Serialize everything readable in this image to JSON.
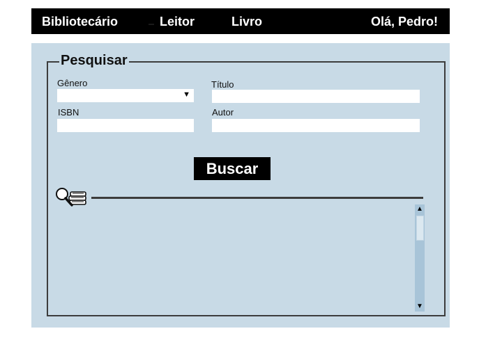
{
  "nav": {
    "items": [
      {
        "label": "Bibliotecário"
      },
      {
        "label": "Leitor"
      },
      {
        "label": "Livro"
      }
    ],
    "greeting": "Olá, Pedro!"
  },
  "search": {
    "legend": "Pesquisar",
    "genero": {
      "label": "Gênero",
      "value": ""
    },
    "titulo": {
      "label": "Título",
      "value": ""
    },
    "isbn": {
      "label": "ISBN",
      "value": ""
    },
    "autor": {
      "label": "Autor",
      "value": ""
    },
    "button_label": "Buscar"
  },
  "results": {
    "icon": "magnifier-books-icon",
    "scroll": {
      "up_icon": "▲",
      "down_icon": "▼"
    }
  },
  "colors": {
    "navbar_bg": "#000000",
    "panel_bg": "#c8dae6",
    "button_bg": "#000000",
    "scrollbar_track": "#a8c4d8"
  }
}
